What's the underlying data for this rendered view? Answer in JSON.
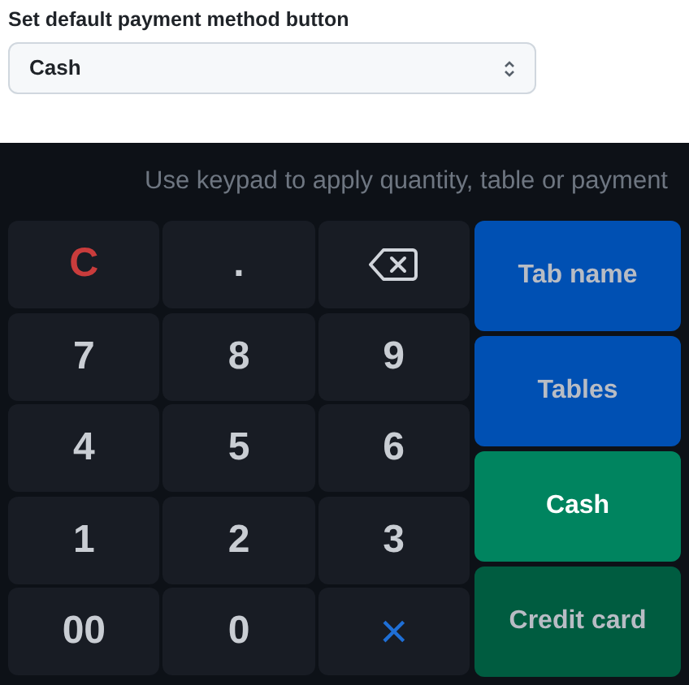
{
  "setting": {
    "label": "Set default payment method button",
    "select": {
      "value": "Cash"
    }
  },
  "keypad": {
    "hint": "Use keypad to apply quantity, table or payment",
    "keys": [
      {
        "kind": "clear",
        "text": "C"
      },
      {
        "kind": "digit",
        "text": "."
      },
      {
        "kind": "backspace"
      },
      {
        "kind": "digit",
        "text": "7"
      },
      {
        "kind": "digit",
        "text": "8"
      },
      {
        "kind": "digit",
        "text": "9"
      },
      {
        "kind": "digit",
        "text": "4"
      },
      {
        "kind": "digit",
        "text": "5"
      },
      {
        "kind": "digit",
        "text": "6"
      },
      {
        "kind": "digit",
        "text": "1"
      },
      {
        "kind": "digit",
        "text": "2"
      },
      {
        "kind": "digit",
        "text": "3"
      },
      {
        "kind": "digit",
        "text": "00"
      },
      {
        "kind": "digit",
        "text": "0"
      },
      {
        "kind": "multiply",
        "text": "×"
      }
    ],
    "actions": [
      {
        "kind": "blue",
        "label": "Tab name",
        "selected": false
      },
      {
        "kind": "blue",
        "label": "Tables",
        "selected": false
      },
      {
        "kind": "green",
        "label": "Cash",
        "selected": true
      },
      {
        "kind": "green",
        "label": "Credit card",
        "selected": false
      }
    ]
  }
}
